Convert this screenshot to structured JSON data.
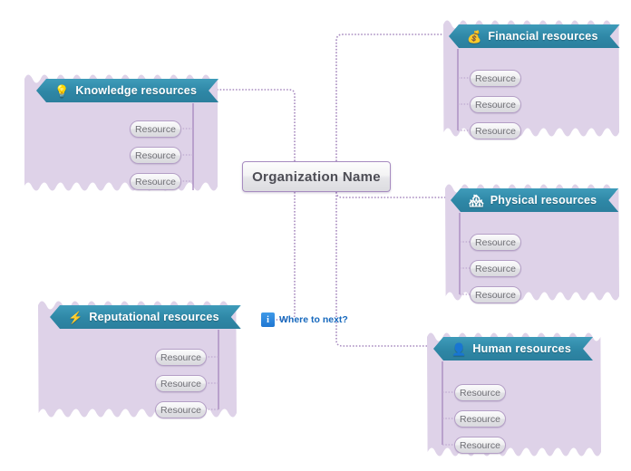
{
  "colors": {
    "canvas_bg": "#ffffff",
    "panel_fill": "#ded2e8",
    "header_teal": "#2e87a6",
    "connector": "#a98cc0",
    "center_border": "#a78cc0",
    "pill_border": "#b49fc6",
    "info_blue": "#1f76d2"
  },
  "center_node": {
    "label": "Organization Name"
  },
  "next_node": {
    "icon": "info-icon",
    "icon_glyph": "i",
    "label": "Where to next?"
  },
  "branches": [
    {
      "id": "knowledge",
      "title": "Knowledge resources",
      "icon": "lightbulb-icon",
      "icon_glyph": "💡",
      "side": "left",
      "children": [
        {
          "label": "Resource"
        },
        {
          "label": "Resource"
        },
        {
          "label": "Resource"
        }
      ]
    },
    {
      "id": "financial",
      "title": "Financial resources",
      "icon": "money-bag-icon",
      "icon_glyph": "💰",
      "side": "right",
      "children": [
        {
          "label": "Resource"
        },
        {
          "label": "Resource"
        },
        {
          "label": "Resource"
        }
      ]
    },
    {
      "id": "physical",
      "title": "Physical resources",
      "icon": "houses-icon",
      "icon_glyph": "🏘",
      "side": "right",
      "children": [
        {
          "label": "Resource"
        },
        {
          "label": "Resource"
        },
        {
          "label": "Resource"
        }
      ]
    },
    {
      "id": "reputational",
      "title": "Reputational resources",
      "icon": "lightning-bolt-icon",
      "icon_glyph": "⚡",
      "side": "left",
      "children": [
        {
          "label": "Resource"
        },
        {
          "label": "Resource"
        },
        {
          "label": "Resource"
        }
      ]
    },
    {
      "id": "human",
      "title": "Human resources",
      "icon": "person-icon",
      "icon_glyph": "👤",
      "side": "right",
      "children": [
        {
          "label": "Resource"
        },
        {
          "label": "Resource"
        },
        {
          "label": "Resource"
        }
      ]
    }
  ]
}
